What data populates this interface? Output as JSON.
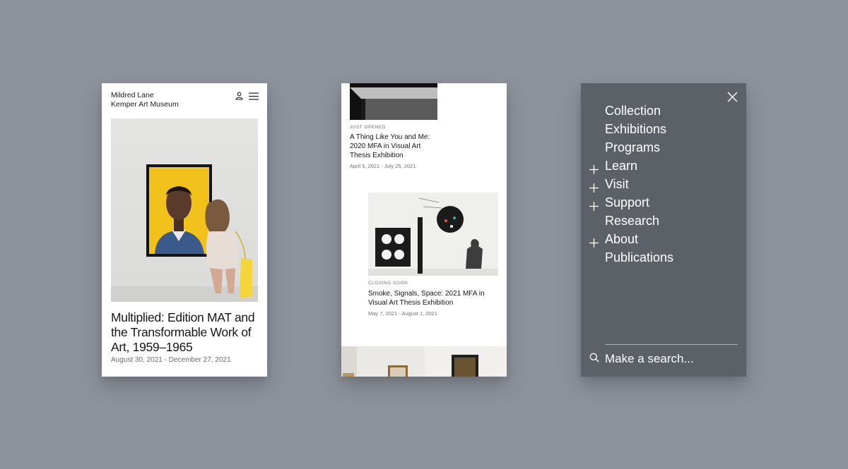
{
  "card1": {
    "brand_line1": "Mildred Lane",
    "brand_line2": "Kemper Art Museum",
    "icons": [
      "account-icon",
      "menu-icon"
    ],
    "title": "Multiplied: Edition MAT and the Transformable Work of Art, 1959–1965",
    "date": "August 30, 2021 - December 27, 2021"
  },
  "card2": {
    "items": [
      {
        "eyebrow": "JUST OPENED",
        "title": "A Thing Like You and Me: 2020 MFA in Visual Art Thesis Exhibition",
        "date": "April 5, 2021 - July 25, 2021"
      },
      {
        "eyebrow": "CLOSING SOON",
        "title": "Smoke, Signals, Space: 2021 MFA in Visual Art Thesis Exhibition",
        "date": "May 7, 2021 - August 1, 2021"
      }
    ]
  },
  "card3": {
    "icons": [
      "close-icon",
      "plus-icon",
      "search-icon"
    ],
    "menu": [
      {
        "label": "Collection",
        "expandable": false
      },
      {
        "label": "Exhibitions",
        "expandable": false
      },
      {
        "label": "Programs",
        "expandable": false
      },
      {
        "label": "Learn",
        "expandable": true
      },
      {
        "label": "Visit",
        "expandable": true
      },
      {
        "label": "Support",
        "expandable": true
      },
      {
        "label": "Research",
        "expandable": false
      },
      {
        "label": "About",
        "expandable": true
      },
      {
        "label": "Publications",
        "expandable": false
      }
    ],
    "search_placeholder": "Make a search..."
  },
  "colors": {
    "background": "#8e939b",
    "menu_panel": "#5c6168",
    "card": "#ffffff"
  }
}
